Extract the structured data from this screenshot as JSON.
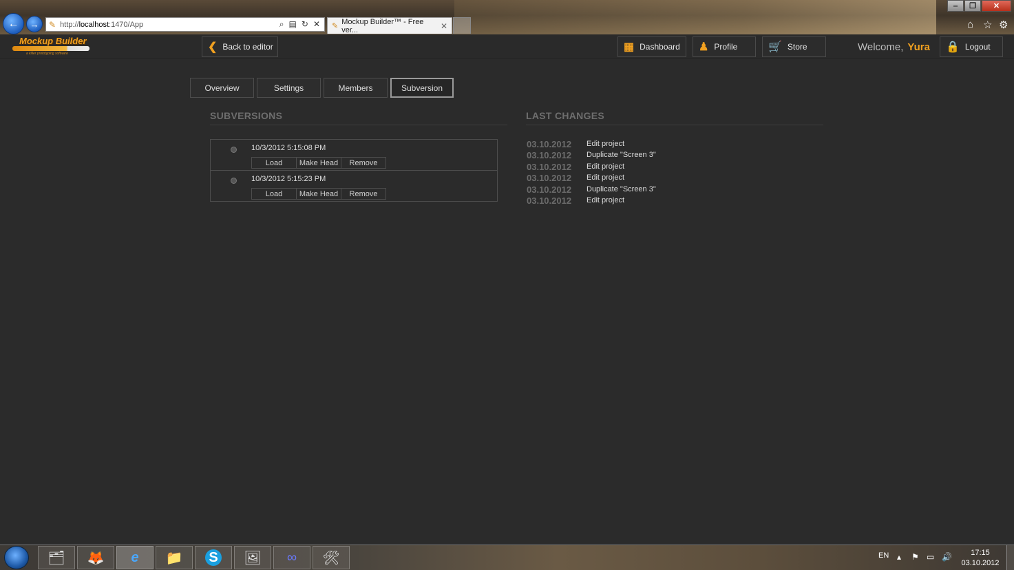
{
  "browser": {
    "url_prefix": "http://",
    "url_host": "localhost",
    "url_rest": ":1470/App",
    "tab_title": "Mockup Builder™ - Free ver...",
    "tab_close": "✕"
  },
  "app": {
    "logo_title": "Mockup Builder",
    "logo_subtitle": "a killer prototyping software",
    "back_label": "Back to editor",
    "nav": {
      "dashboard": "Dashboard",
      "profile": "Profile",
      "store": "Store",
      "logout": "Logout"
    },
    "welcome_label": "Welcome,",
    "user_name": "Yura",
    "accent_color": "#f0a020"
  },
  "tabs": [
    {
      "label": "Overview",
      "active": false
    },
    {
      "label": "Settings",
      "active": false
    },
    {
      "label": "Members",
      "active": false
    },
    {
      "label": "Subversion",
      "active": true
    }
  ],
  "subversions": {
    "title": "SUBVERSIONS",
    "items": [
      {
        "date": "10/3/2012 5:15:08 PM",
        "load": "Load",
        "make_head": "Make Head",
        "remove": "Remove"
      },
      {
        "date": "10/3/2012 5:15:23 PM",
        "load": "Load",
        "make_head": "Make Head",
        "remove": "Remove"
      }
    ]
  },
  "last_changes": {
    "title": "LAST CHANGES",
    "rows": [
      {
        "date": "03.10.2012",
        "action": "Edit project"
      },
      {
        "date": "03.10.2012",
        "action": "Duplicate \"Screen 3\""
      },
      {
        "date": "03.10.2012",
        "action": "Edit project"
      },
      {
        "date": "03.10.2012",
        "action": "Edit project"
      },
      {
        "date": "03.10.2012",
        "action": "Duplicate \"Screen 3\""
      },
      {
        "date": "03.10.2012",
        "action": "Edit project"
      }
    ]
  },
  "taskbar": {
    "apps": [
      "file-explorer-icon",
      "firefox-icon",
      "internet-explorer-icon",
      "folder-icon",
      "skype-icon",
      "image-viewer-icon",
      "infinity-app-icon",
      "tools-icon"
    ],
    "language": "EN",
    "time": "17:15",
    "date": "03.10.2012"
  }
}
